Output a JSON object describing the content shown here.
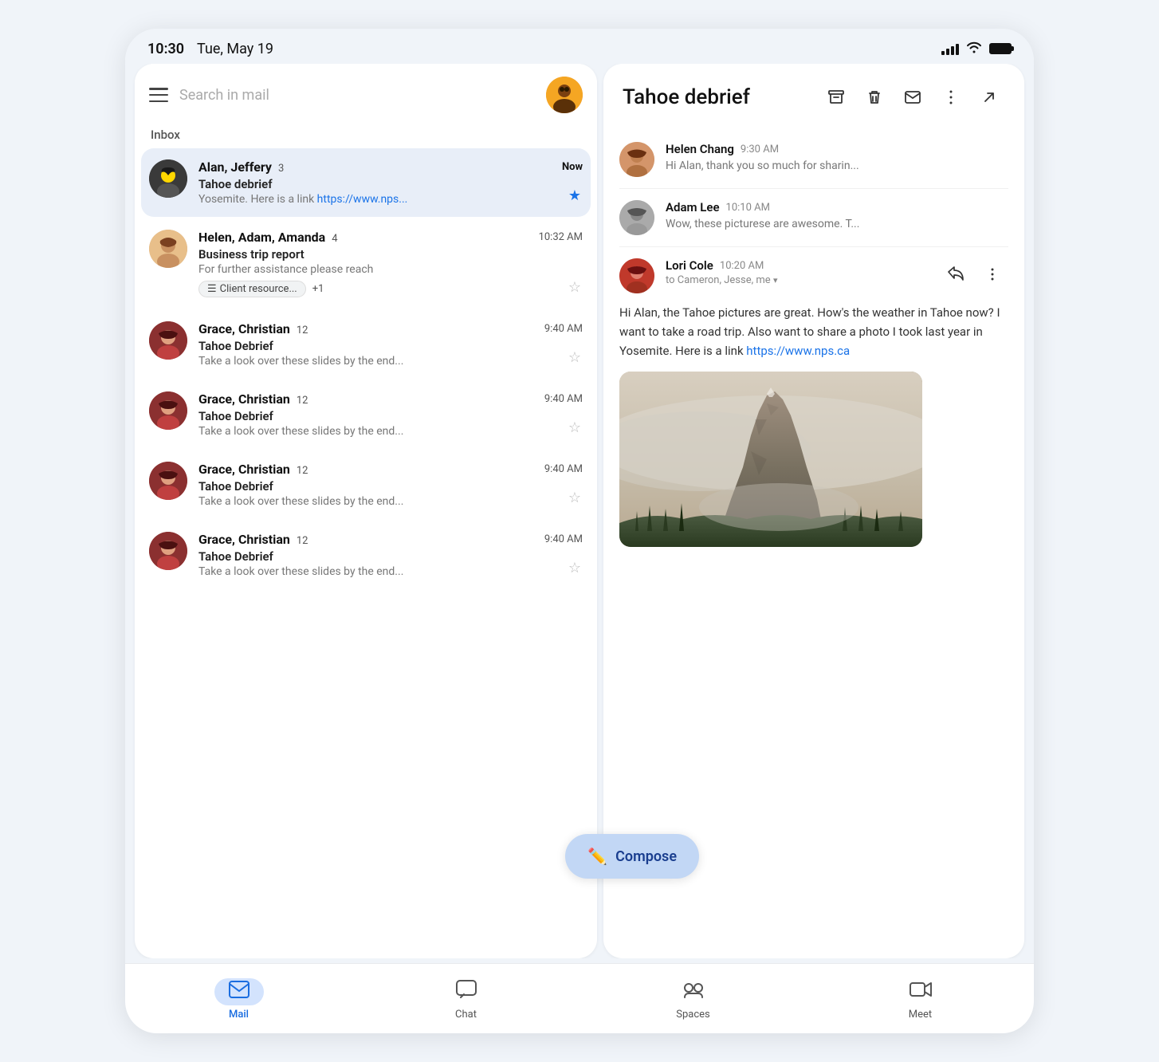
{
  "statusBar": {
    "time": "10:30",
    "date": "Tue, May 19"
  },
  "searchBar": {
    "placeholder": "Search in mail"
  },
  "inboxLabel": "Inbox",
  "emails": [
    {
      "sender": "Alan, Jeffery",
      "count": 3,
      "subject": "Tahoe debrief",
      "preview": "Yosemite. Here is a link",
      "link": "https://www.nps...",
      "time": "Now",
      "starred": true,
      "active": true,
      "avatarType": "alan"
    },
    {
      "sender": "Helen, Adam, Amanda",
      "count": 4,
      "subject": "Business trip report",
      "preview": "For further assistance please reach",
      "time": "10:32 AM",
      "starred": false,
      "active": false,
      "avatarType": "helen",
      "tags": [
        "Client resource...",
        "+1"
      ]
    },
    {
      "sender": "Grace, Christian",
      "count": 12,
      "subject": "Tahoe Debrief",
      "preview": "Take a look over these slides by the end...",
      "time": "9:40 AM",
      "starred": false,
      "active": false,
      "avatarType": "grace"
    },
    {
      "sender": "Grace, Christian",
      "count": 12,
      "subject": "Tahoe Debrief",
      "preview": "Take a look over these slides by the end...",
      "time": "9:40 AM",
      "starred": false,
      "active": false,
      "avatarType": "grace"
    },
    {
      "sender": "Grace, Christian",
      "count": 12,
      "subject": "Tahoe Debrief",
      "preview": "Take a look over these slides by the end...",
      "time": "9:40 AM",
      "starred": false,
      "active": false,
      "avatarType": "grace"
    },
    {
      "sender": "Grace, Christian",
      "count": 12,
      "subject": "Tahoe Debrief",
      "preview": "Take a look over these slides by the end...",
      "time": "9:40 AM",
      "starred": false,
      "active": false,
      "avatarType": "grace"
    }
  ],
  "detail": {
    "title": "Tahoe debrief",
    "actions": [
      "archive",
      "delete",
      "email",
      "more",
      "expand"
    ],
    "messages": [
      {
        "sender": "Helen Chang",
        "time": "9:30 AM",
        "preview": "Hi Alan, thank you so much for sharin...",
        "avatarType": "helen"
      },
      {
        "sender": "Adam Lee",
        "time": "10:10 AM",
        "preview": "Wow, these picturese are awesome. T...",
        "avatarType": "adam"
      }
    ],
    "expandedMessage": {
      "sender": "Lori Cole",
      "time": "10:20 AM",
      "to": "to Cameron, Jesse, me",
      "body": "Hi Alan, the Tahoe pictures are great. How's the weather in Tahoe now? I want to take a road trip. Also want to share a photo I took last year in Yosemite. Here is a link",
      "link": "https://www.nps.ca",
      "avatarType": "lori"
    }
  },
  "compose": {
    "label": "Compose"
  },
  "bottomNav": [
    {
      "label": "Mail",
      "icon": "mail",
      "active": true
    },
    {
      "label": "Chat",
      "icon": "chat",
      "active": false
    },
    {
      "label": "Spaces",
      "icon": "spaces",
      "active": false
    },
    {
      "label": "Meet",
      "icon": "meet",
      "active": false
    }
  ]
}
